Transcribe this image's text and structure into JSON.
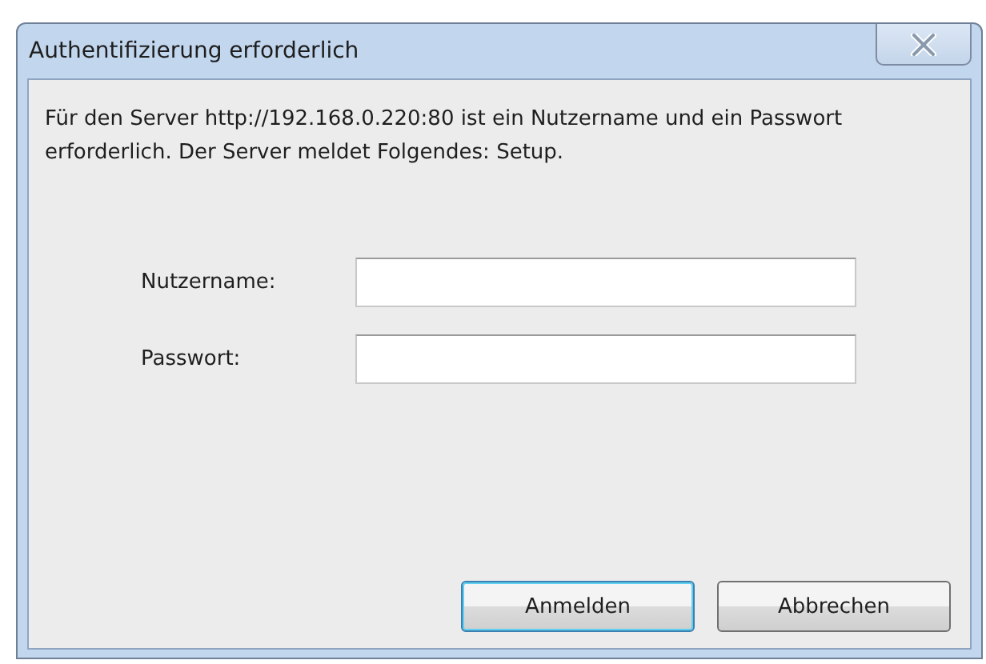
{
  "window": {
    "title": "Authentifizierung erforderlich"
  },
  "message": "Für den Server http://192.168.0.220:80 ist ein Nutzername und ein Passwort erforderlich. Der Server meldet Folgendes: Setup.",
  "fields": [
    {
      "label": "Nutzername:"
    },
    {
      "label": "Passwort:"
    }
  ],
  "buttons": [
    {
      "label": "Anmelden",
      "default": true
    },
    {
      "label": "Abbrechen",
      "default": false
    }
  ]
}
